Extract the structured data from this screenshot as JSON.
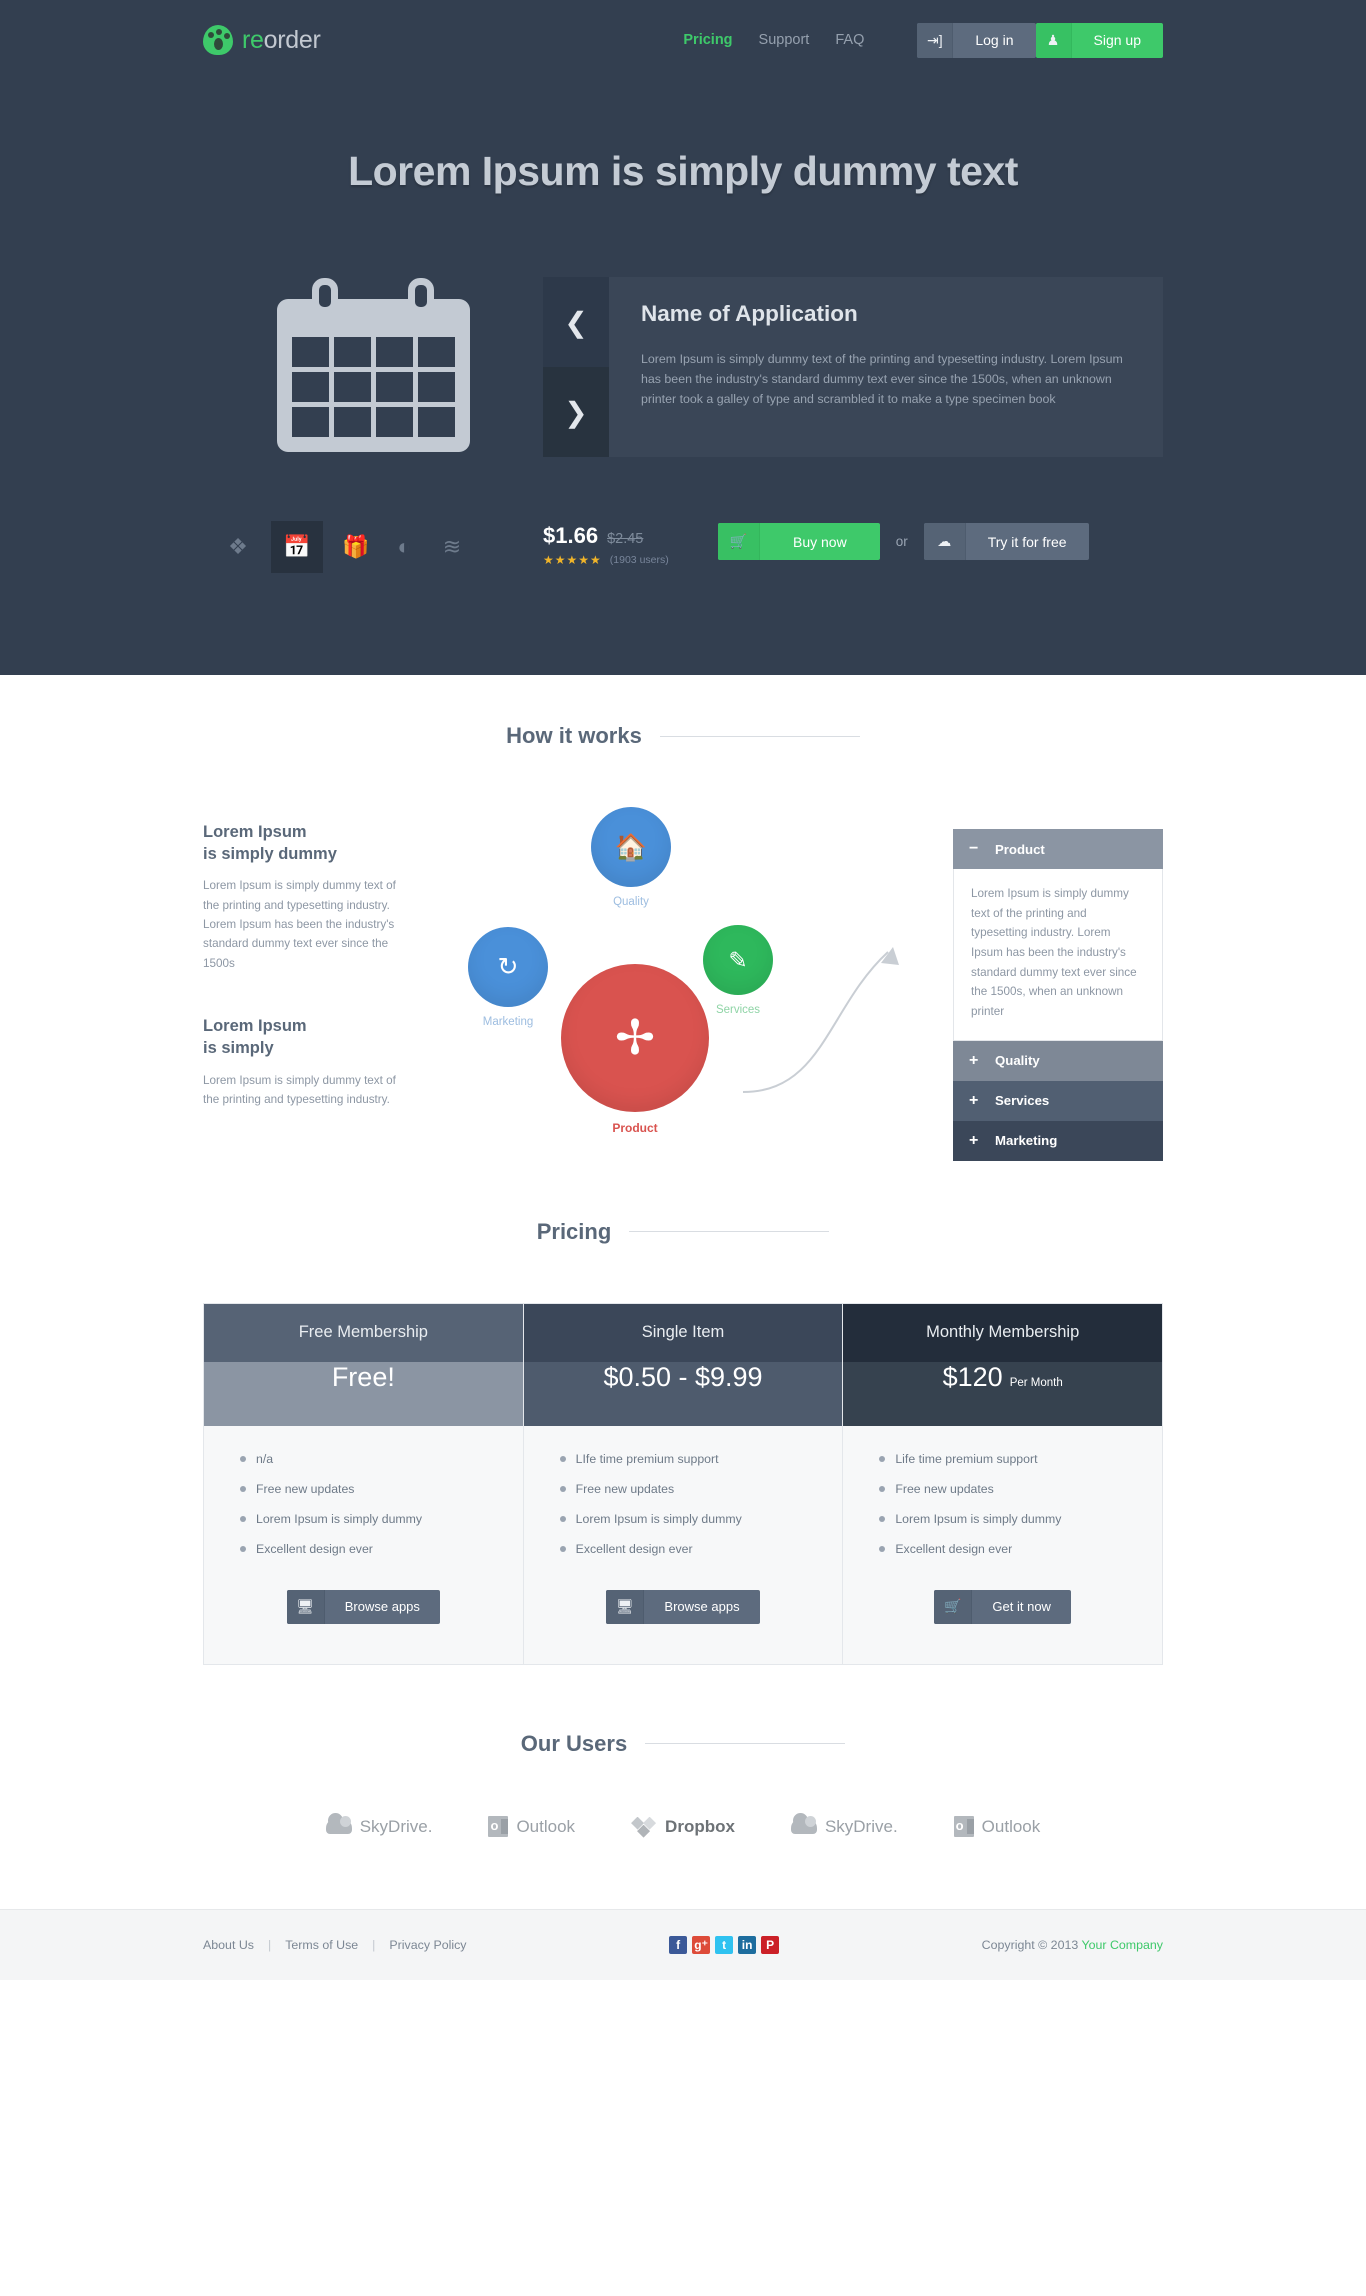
{
  "brand": {
    "name_accent": "re",
    "name_rest": "order"
  },
  "nav": {
    "items": [
      {
        "label": "Pricing",
        "active": true
      },
      {
        "label": "Support",
        "active": false
      },
      {
        "label": "FAQ",
        "active": false
      }
    ],
    "login_label": "Log in",
    "login_icon": "login-arrow-icon",
    "signup_label": "Sign up",
    "signup_icon": "user-icon"
  },
  "hero": {
    "title": "Lorem Ipsum is simply dummy text",
    "app_icon": "calendar-icon",
    "slider": {
      "prev_icon": "chevron-left-icon",
      "next_icon": "chevron-right-icon",
      "title": "Name of Application",
      "body": "Lorem Ipsum is simply dummy text of the printing and typesetting industry. Lorem Ipsum has been the industry's standard dummy text ever since the 1500s, when an unknown printer took a galley of type and scrambled it to make a type specimen book"
    },
    "thumbs": [
      {
        "icon": "leaf-icon",
        "glyph": "❦",
        "selected": false
      },
      {
        "icon": "calendar-icon",
        "glyph": "",
        "selected": true
      },
      {
        "icon": "gift-icon",
        "glyph": "Ἰ1",
        "selected": false
      },
      {
        "icon": "dashboard-icon",
        "glyph": "◔",
        "selected": false
      },
      {
        "icon": "rss-icon",
        "glyph": "≋",
        "selected": false
      }
    ],
    "price_current": "$1.66",
    "price_old": "$2.45",
    "stars": "★★★★★",
    "rating_count": "(1903 users)",
    "buy_label": "Buy now",
    "buy_icon": "cart-icon",
    "or_label": "or",
    "try_label": "Try it for free",
    "try_icon": "cloud-download-icon"
  },
  "how_it_works": {
    "heading": "How it works",
    "blocks": [
      {
        "title_line1": "Lorem Ipsum",
        "title_line2": "is simply dummy",
        "body": "Lorem Ipsum is simply dummy text of the printing and typesetting industry. Lorem Ipsum has been the industry's standard dummy text ever since the 1500s"
      },
      {
        "title_line1": "Lorem Ipsum",
        "title_line2": "is simply",
        "body": "Lorem Ipsum is simply dummy text of the printing and typesetting industry."
      }
    ],
    "nodes": [
      {
        "label": "Quality",
        "icon": "home-icon",
        "color": "#4a90d9"
      },
      {
        "label": "Marketing",
        "icon": "refresh-icon",
        "color": "#4a90d9"
      },
      {
        "label": "Services",
        "icon": "pencil-icon",
        "color": "#2eb85c"
      },
      {
        "label": "Product",
        "icon": "shuffle-icon",
        "color": "#d9534f"
      }
    ],
    "accordion": [
      {
        "label": "Product",
        "sign": "−",
        "expanded": true,
        "body": "Lorem Ipsum is simply dummy text of the printing and typesetting industry. Lorem Ipsum has been the industry's standard dummy text ever since the 1500s, when an unknown printer"
      },
      {
        "label": "Quality",
        "sign": "+",
        "expanded": false
      },
      {
        "label": "Services",
        "sign": "+",
        "expanded": false
      },
      {
        "label": "Marketing",
        "sign": "+",
        "expanded": false
      }
    ]
  },
  "pricing": {
    "heading": "Pricing",
    "plans": [
      {
        "name": "Free Membership",
        "amount": "Free!",
        "per": "",
        "features": [
          "n/a",
          "Free new updates",
          "Lorem Ipsum is simply dummy",
          "Excellent design ever"
        ],
        "button_label": "Browse apps",
        "button_icon": "monitor-icon"
      },
      {
        "name": "Single Item",
        "amount": "$0.50 - $9.99",
        "per": "",
        "features": [
          "LIfe time premium support",
          "Free new updates",
          "Lorem Ipsum is simply dummy",
          "Excellent design ever"
        ],
        "button_label": "Browse apps",
        "button_icon": "monitor-icon"
      },
      {
        "name": "Monthly Membership",
        "amount": "$120",
        "per": "Per Month",
        "features": [
          "Life time premium support",
          "Free new updates",
          "Lorem Ipsum is simply dummy",
          "Excellent design ever"
        ],
        "button_label": "Get it now",
        "button_icon": "cart-icon"
      }
    ]
  },
  "our_users": {
    "heading": "Our Users",
    "logos": [
      {
        "name": "SkyDrive.",
        "icon": "cloud-icon",
        "bold": false
      },
      {
        "name": "Outlook",
        "icon": "outlook-icon",
        "bold": false
      },
      {
        "name": "Dropbox",
        "icon": "dropbox-icon",
        "bold": true
      },
      {
        "name": "SkyDrive.",
        "icon": "cloud-icon",
        "bold": false
      },
      {
        "name": "Outlook",
        "icon": "outlook-icon",
        "bold": false
      }
    ]
  },
  "footer": {
    "links": [
      "About Us",
      "Terms of Use",
      "Privacy Policy"
    ],
    "social": [
      {
        "name": "facebook-icon",
        "glyph": "f",
        "color": "#3b5998"
      },
      {
        "name": "googleplus-icon",
        "glyph": "g⁺",
        "color": "#dd4b39"
      },
      {
        "name": "twitter-icon",
        "glyph": "t",
        "color": "#2fc2f0"
      },
      {
        "name": "linkedin-icon",
        "glyph": "in",
        "color": "#1d6d9e"
      },
      {
        "name": "pinterest-icon",
        "glyph": "P",
        "color": "#cb2027"
      }
    ],
    "copyright_prefix": "Copyright © 2013 ",
    "company": "Your Company"
  },
  "colors": {
    "dark": "#333f50",
    "green": "#3ec96a",
    "slate": "#5d6b7e",
    "blue": "#4a90d9",
    "red": "#d9534f",
    "star": "#f0b429"
  }
}
